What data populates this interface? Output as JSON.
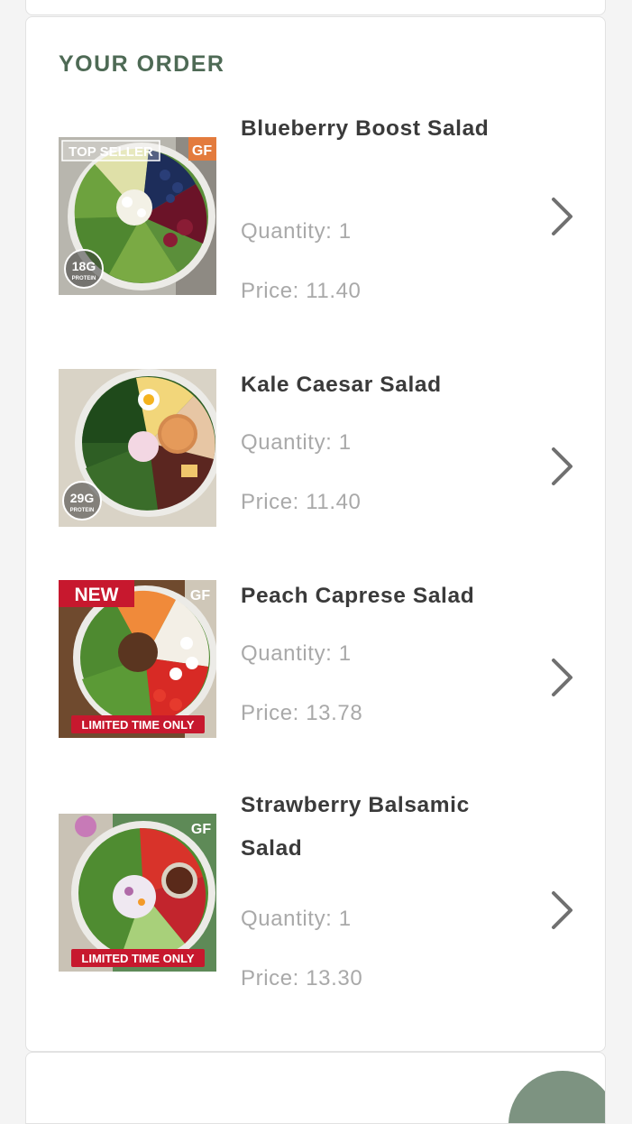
{
  "section_title": "YOUR ORDER",
  "colors": {
    "accent_green": "#4e6a55",
    "name_text": "#3a3a3a",
    "meta_text": "#a9a9a9",
    "chevron": "#707070",
    "badge_red": "#c7182e",
    "fab": "#7d9381"
  },
  "items": [
    {
      "name": "Blueberry Boost Salad",
      "quantity": "Quantity: 1",
      "price": "Price: 11.40",
      "image_badges": {
        "top_left": "TOP SELLER",
        "top_right": "GF",
        "protein_number": "18G",
        "protein_word": "PROTEIN"
      }
    },
    {
      "name": "Kale Caesar Salad",
      "quantity": "Quantity: 1",
      "price": "Price: 11.40",
      "image_badges": {
        "protein_number": "29G",
        "protein_word": "PROTEIN"
      }
    },
    {
      "name": "Peach Caprese Salad",
      "quantity": "Quantity: 1",
      "price": "Price: 13.78",
      "image_badges": {
        "top_left": "NEW",
        "top_right": "GF",
        "bottom": "LIMITED TIME ONLY"
      }
    },
    {
      "name": "Strawberry Balsamic Salad",
      "quantity": "Quantity: 1",
      "price": "Price: 13.30",
      "image_badges": {
        "top_right": "GF",
        "bottom": "LIMITED TIME ONLY"
      }
    }
  ],
  "icons": {
    "chevron": "chevron-right-icon"
  }
}
